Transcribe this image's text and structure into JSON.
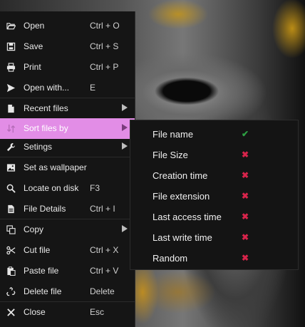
{
  "menu": {
    "items": [
      {
        "label": "Open",
        "shortcut": "Ctrl + O",
        "icon": "folder-open-icon"
      },
      {
        "label": "Save",
        "shortcut": "Ctrl + S",
        "icon": "floppy-disk-icon"
      },
      {
        "label": "Print",
        "shortcut": "Ctrl + P",
        "icon": "printer-icon"
      },
      {
        "label": "Open with...",
        "shortcut": "E",
        "icon": "send-arrow-icon"
      },
      {
        "label": "Recent files",
        "shortcut": "",
        "icon": "document-icon"
      },
      {
        "label": "Sort files by",
        "shortcut": "",
        "icon": "sort-icon"
      },
      {
        "label": "Setings",
        "shortcut": "",
        "icon": "wrench-icon"
      },
      {
        "label": "Set as wallpaper",
        "shortcut": "",
        "icon": "image-icon"
      },
      {
        "label": "Locate on disk",
        "shortcut": "F3",
        "icon": "magnifier-icon"
      },
      {
        "label": "File Details",
        "shortcut": "Ctrl + I",
        "icon": "file-details-icon"
      },
      {
        "label": "Copy",
        "shortcut": "",
        "icon": "copy-icon"
      },
      {
        "label": "Cut file",
        "shortcut": "Ctrl + X",
        "icon": "scissors-icon"
      },
      {
        "label": "Paste file",
        "shortcut": "Ctrl + V",
        "icon": "paste-icon"
      },
      {
        "label": "Delete file",
        "shortcut": "Delete",
        "icon": "recycle-icon"
      },
      {
        "label": "Close",
        "shortcut": "Esc",
        "icon": "close-x-icon"
      }
    ],
    "active_item": "Sort files by",
    "active_color": "#e28de6"
  },
  "submenu": {
    "items": [
      {
        "label": "File name",
        "state": "✔",
        "selected": true
      },
      {
        "label": "File Size",
        "state": "✖",
        "selected": false
      },
      {
        "label": "Creation time",
        "state": "✖",
        "selected": false
      },
      {
        "label": "File extension",
        "state": "✖",
        "selected": false
      },
      {
        "label": "Last access time",
        "state": "✖",
        "selected": false
      },
      {
        "label": "Last write time",
        "state": "✖",
        "selected": false
      },
      {
        "label": "Random",
        "state": "✖",
        "selected": false
      }
    ],
    "check_color": "#2ea043",
    "cross_color": "#d8244b"
  }
}
